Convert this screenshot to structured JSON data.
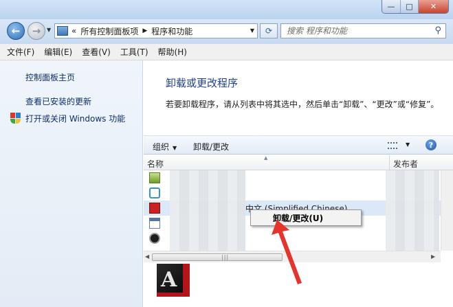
{
  "window": {
    "caption_minimize": "—",
    "caption_maximize": "□",
    "caption_close": "✕"
  },
  "nav": {
    "back_icon": "←",
    "forward_icon": "→",
    "breadcrumb_root": "所有控制面板项",
    "breadcrumb_current": "程序和功能",
    "search_placeholder": "搜索 程序和功能"
  },
  "menubar": {
    "items": [
      "文件(F)",
      "编辑(E)",
      "查看(V)",
      "工具(T)",
      "帮助(H)"
    ]
  },
  "sidebar": {
    "home": "控制面板主页",
    "updates": "查看已安装的更新",
    "features": "打开或关闭 Windows 功能"
  },
  "main": {
    "title": "卸载或更改程序",
    "description": "若要卸载程序，请从列表中将其选中，然后单击“卸载”、“更改”或“修复”。"
  },
  "toolbar": {
    "organize": "组织",
    "uninstall_change": "卸载/更改"
  },
  "columns": {
    "name": "名称",
    "publisher": "发布者"
  },
  "list": {
    "selected_row_text": "中文 (Simplified Chinese)"
  },
  "context_menu": {
    "uninstall": "卸载/更改(U)"
  },
  "colors": {
    "accent_title": "#1f3f99",
    "arrow": "#e8332a"
  }
}
